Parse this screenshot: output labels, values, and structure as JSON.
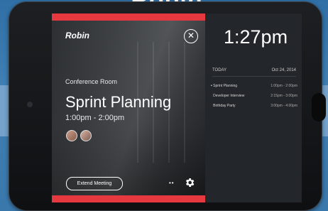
{
  "header": {
    "brand": "Robin"
  },
  "left": {
    "logo": "Robin",
    "close_icon_label": "✕",
    "room_label": "Conference Room",
    "meeting_title": "Sprint Planning",
    "meeting_time": "1:00pm - 2:00pm",
    "extend_label": "Extend Meeting",
    "dots_label": "••",
    "accent_color": "#e5383f"
  },
  "right": {
    "clock": "1:27pm",
    "day_label": "TODAY",
    "date": "Oct 24, 2014",
    "events": [
      {
        "name": "Sprint Planning",
        "time": "1:00pm - 2:00pm",
        "active": true
      },
      {
        "name": "Developer Interview",
        "time": "2:15pm - 3:00pm",
        "active": false
      },
      {
        "name": "Birthday Party",
        "time": "3:00pm - 4:00pm",
        "active": false
      }
    ]
  },
  "icons": {
    "settings": "gear-icon",
    "close": "close-icon"
  }
}
